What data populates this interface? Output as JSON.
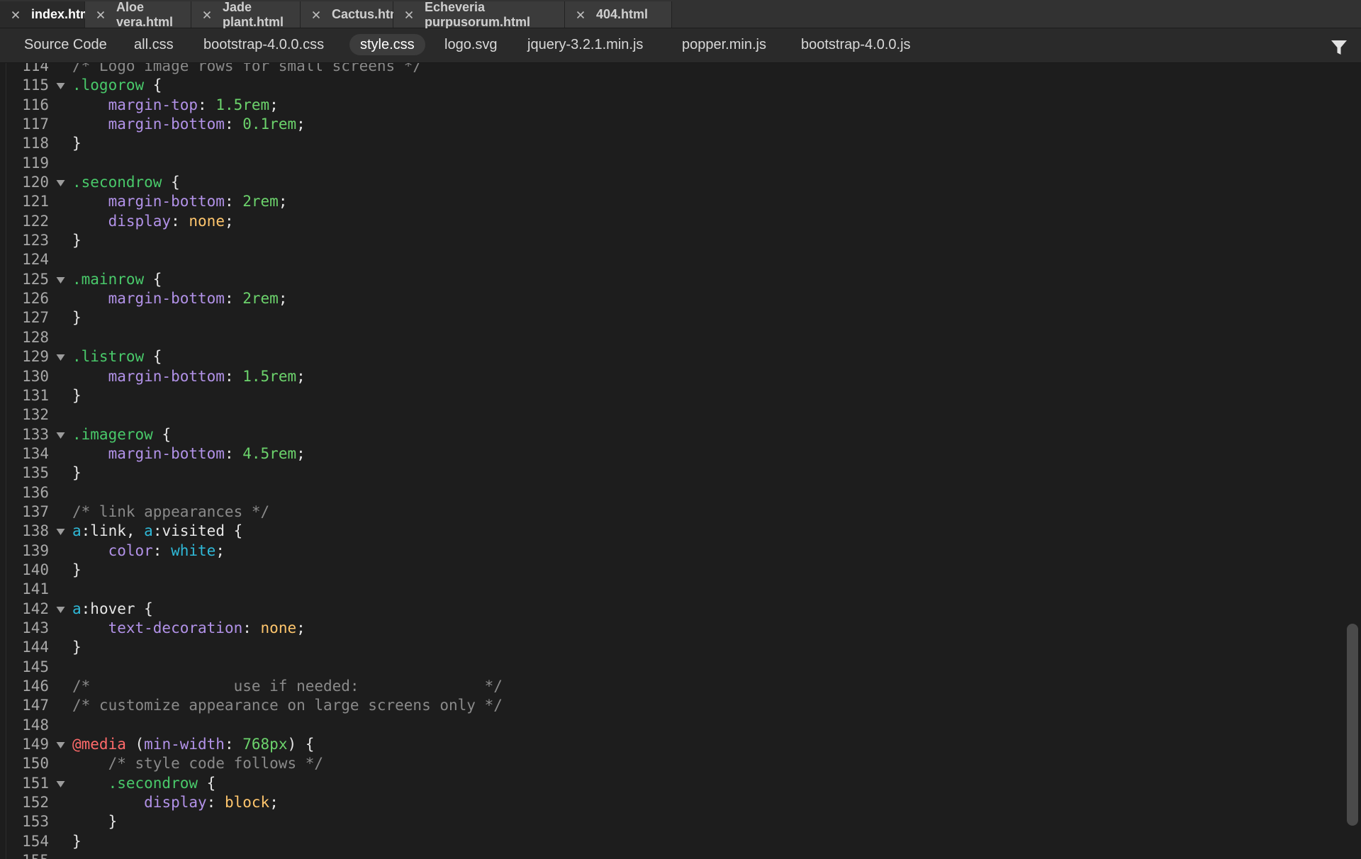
{
  "tabs": [
    {
      "label": "index.html",
      "active": true
    },
    {
      "label": "Aloe vera.html",
      "active": false
    },
    {
      "label": "Jade plant.html",
      "active": false
    },
    {
      "label": "Cactus.html",
      "active": false
    },
    {
      "label": "Echeveria purpusorum.html",
      "active": false
    },
    {
      "label": "404.html",
      "active": false
    }
  ],
  "related_files": [
    {
      "label": "Source Code",
      "active": false
    },
    {
      "label": "all.css",
      "active": false
    },
    {
      "label": "bootstrap-4.0.0.css",
      "active": false
    },
    {
      "label": "style.css",
      "active": true
    },
    {
      "label": "logo.svg",
      "active": false
    },
    {
      "label": "jquery-3.2.1.min.js",
      "active": false
    },
    {
      "label": "popper.min.js",
      "active": false
    },
    {
      "label": "bootstrap-4.0.0.js",
      "active": false
    }
  ],
  "toolbar": {
    "filter_icon": "funnel-icon"
  },
  "icons": {
    "tab_close": "close-icon",
    "code_fold": "fold-triangle-icon"
  },
  "colors": {
    "selector": "#49c96a",
    "property": "#b292e8",
    "number": "#6cd36c",
    "keyword": "#ffc66d",
    "comment": "#8a8a8a",
    "html_tag": "#2fb9d8",
    "at_rule": "#ff6a6a",
    "text": "#e6e6e6",
    "editor_background": "#1d1d1d"
  },
  "editor": {
    "lines": [
      {
        "n": "114",
        "fold": false,
        "tokens": [
          [
            "com",
            "/* Logo image rows for small screens */"
          ]
        ]
      },
      {
        "n": "115",
        "fold": true,
        "tokens": [
          [
            "sel",
            ".logorow"
          ],
          [
            "punc",
            " {"
          ]
        ]
      },
      {
        "n": "116",
        "fold": false,
        "tokens": [
          [
            "punc",
            "    "
          ],
          [
            "prop",
            "margin-top"
          ],
          [
            "punc",
            ": "
          ],
          [
            "num",
            "1.5rem"
          ],
          [
            "punc",
            ";"
          ]
        ]
      },
      {
        "n": "117",
        "fold": false,
        "tokens": [
          [
            "punc",
            "    "
          ],
          [
            "prop",
            "margin-bottom"
          ],
          [
            "punc",
            ": "
          ],
          [
            "num",
            "0.1rem"
          ],
          [
            "punc",
            ";"
          ]
        ]
      },
      {
        "n": "118",
        "fold": false,
        "tokens": [
          [
            "punc",
            "}"
          ]
        ]
      },
      {
        "n": "119",
        "fold": false,
        "tokens": []
      },
      {
        "n": "120",
        "fold": true,
        "tokens": [
          [
            "sel",
            ".secondrow"
          ],
          [
            "punc",
            " {"
          ]
        ]
      },
      {
        "n": "121",
        "fold": false,
        "tokens": [
          [
            "punc",
            "    "
          ],
          [
            "prop",
            "margin-bottom"
          ],
          [
            "punc",
            ": "
          ],
          [
            "num",
            "2rem"
          ],
          [
            "punc",
            ";"
          ]
        ]
      },
      {
        "n": "122",
        "fold": false,
        "tokens": [
          [
            "punc",
            "    "
          ],
          [
            "prop",
            "display"
          ],
          [
            "punc",
            ": "
          ],
          [
            "kw",
            "none"
          ],
          [
            "punc",
            ";"
          ]
        ]
      },
      {
        "n": "123",
        "fold": false,
        "tokens": [
          [
            "punc",
            "}"
          ]
        ]
      },
      {
        "n": "124",
        "fold": false,
        "tokens": []
      },
      {
        "n": "125",
        "fold": true,
        "tokens": [
          [
            "sel",
            ".mainrow"
          ],
          [
            "punc",
            " {"
          ]
        ]
      },
      {
        "n": "126",
        "fold": false,
        "tokens": [
          [
            "punc",
            "    "
          ],
          [
            "prop",
            "margin-bottom"
          ],
          [
            "punc",
            ": "
          ],
          [
            "num",
            "2rem"
          ],
          [
            "punc",
            ";"
          ]
        ]
      },
      {
        "n": "127",
        "fold": false,
        "tokens": [
          [
            "punc",
            "}"
          ]
        ]
      },
      {
        "n": "128",
        "fold": false,
        "tokens": []
      },
      {
        "n": "129",
        "fold": true,
        "tokens": [
          [
            "sel",
            ".listrow"
          ],
          [
            "punc",
            " {"
          ]
        ]
      },
      {
        "n": "130",
        "fold": false,
        "tokens": [
          [
            "punc",
            "    "
          ],
          [
            "prop",
            "margin-bottom"
          ],
          [
            "punc",
            ": "
          ],
          [
            "num",
            "1.5rem"
          ],
          [
            "punc",
            ";"
          ]
        ]
      },
      {
        "n": "131",
        "fold": false,
        "tokens": [
          [
            "punc",
            "}"
          ]
        ]
      },
      {
        "n": "132",
        "fold": false,
        "tokens": []
      },
      {
        "n": "133",
        "fold": true,
        "tokens": [
          [
            "sel",
            ".imagerow"
          ],
          [
            "punc",
            " {"
          ]
        ]
      },
      {
        "n": "134",
        "fold": false,
        "tokens": [
          [
            "punc",
            "    "
          ],
          [
            "prop",
            "margin-bottom"
          ],
          [
            "punc",
            ": "
          ],
          [
            "num",
            "4.5rem"
          ],
          [
            "punc",
            ";"
          ]
        ]
      },
      {
        "n": "135",
        "fold": false,
        "tokens": [
          [
            "punc",
            "}"
          ]
        ]
      },
      {
        "n": "136",
        "fold": false,
        "tokens": []
      },
      {
        "n": "137",
        "fold": false,
        "tokens": [
          [
            "com",
            "/* link appearances */"
          ]
        ]
      },
      {
        "n": "138",
        "fold": true,
        "tokens": [
          [
            "tag",
            "a"
          ],
          [
            "punc",
            ":link, "
          ],
          [
            "tag",
            "a"
          ],
          [
            "punc",
            ":visited {"
          ]
        ]
      },
      {
        "n": "139",
        "fold": false,
        "tokens": [
          [
            "punc",
            "    "
          ],
          [
            "prop",
            "color"
          ],
          [
            "punc",
            ": "
          ],
          [
            "color",
            "white"
          ],
          [
            "punc",
            ";"
          ]
        ]
      },
      {
        "n": "140",
        "fold": false,
        "tokens": [
          [
            "punc",
            "}"
          ]
        ]
      },
      {
        "n": "141",
        "fold": false,
        "tokens": []
      },
      {
        "n": "142",
        "fold": true,
        "tokens": [
          [
            "tag",
            "a"
          ],
          [
            "punc",
            ":hover {"
          ]
        ]
      },
      {
        "n": "143",
        "fold": false,
        "tokens": [
          [
            "punc",
            "    "
          ],
          [
            "prop",
            "text-decoration"
          ],
          [
            "punc",
            ": "
          ],
          [
            "kw",
            "none"
          ],
          [
            "punc",
            ";"
          ]
        ]
      },
      {
        "n": "144",
        "fold": false,
        "tokens": [
          [
            "punc",
            "}"
          ]
        ]
      },
      {
        "n": "145",
        "fold": false,
        "tokens": []
      },
      {
        "n": "146",
        "fold": false,
        "tokens": [
          [
            "com",
            "/*                use if needed:              */"
          ]
        ]
      },
      {
        "n": "147",
        "fold": false,
        "tokens": [
          [
            "com",
            "/* customize appearance on large screens only */"
          ]
        ]
      },
      {
        "n": "148",
        "fold": false,
        "tokens": []
      },
      {
        "n": "149",
        "fold": true,
        "tokens": [
          [
            "at",
            "@media"
          ],
          [
            "punc",
            " ("
          ],
          [
            "prop",
            "min-width"
          ],
          [
            "punc",
            ": "
          ],
          [
            "num",
            "768px"
          ],
          [
            "punc",
            ") {"
          ]
        ]
      },
      {
        "n": "150",
        "fold": false,
        "tokens": [
          [
            "punc",
            "    "
          ],
          [
            "com",
            "/* style code follows */"
          ]
        ]
      },
      {
        "n": "151",
        "fold": true,
        "tokens": [
          [
            "punc",
            "    "
          ],
          [
            "sel",
            ".secondrow"
          ],
          [
            "punc",
            " {"
          ]
        ]
      },
      {
        "n": "152",
        "fold": false,
        "tokens": [
          [
            "punc",
            "        "
          ],
          [
            "prop",
            "display"
          ],
          [
            "punc",
            ": "
          ],
          [
            "kw",
            "block"
          ],
          [
            "punc",
            ";"
          ]
        ]
      },
      {
        "n": "153",
        "fold": false,
        "tokens": [
          [
            "punc",
            "    }"
          ]
        ]
      },
      {
        "n": "154",
        "fold": false,
        "tokens": [
          [
            "punc",
            "}"
          ]
        ]
      },
      {
        "n": "155",
        "fold": false,
        "tokens": []
      }
    ]
  }
}
